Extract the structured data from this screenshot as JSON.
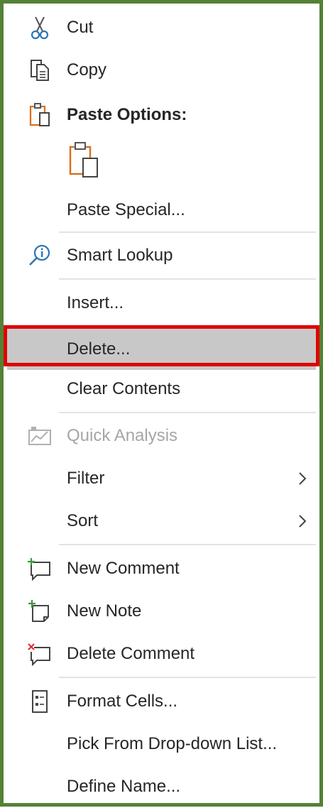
{
  "menu": {
    "items": [
      {
        "label": "Cut",
        "icon": "scissors-icon"
      },
      {
        "label": "Copy",
        "icon": "copy-icon"
      },
      {
        "label": "Paste Options:",
        "icon": "paste-icon"
      },
      {
        "label": "Paste Special...",
        "icon": ""
      },
      {
        "label": "Smart Lookup",
        "icon": "smart-lookup-icon"
      },
      {
        "label": "Insert...",
        "icon": ""
      },
      {
        "label": "Delete...",
        "icon": "",
        "selected": true
      },
      {
        "label": "Clear Contents",
        "icon": ""
      },
      {
        "label": "Quick Analysis",
        "icon": "quick-analysis-icon",
        "disabled": true
      },
      {
        "label": "Filter",
        "icon": "",
        "submenu": true
      },
      {
        "label": "Sort",
        "icon": "",
        "submenu": true
      },
      {
        "label": "New Comment",
        "icon": "new-comment-icon"
      },
      {
        "label": "New Note",
        "icon": "new-note-icon"
      },
      {
        "label": "Delete Comment",
        "icon": "delete-comment-icon"
      },
      {
        "label": "Format Cells...",
        "icon": "format-cells-icon"
      },
      {
        "label": "Pick From Drop-down List...",
        "icon": ""
      },
      {
        "label": "Define Name...",
        "icon": ""
      }
    ],
    "paste_option_icon": "paste-keep-source-icon"
  },
  "colors": {
    "frame": "#548235",
    "highlight_border": "#e00000",
    "selected_bg": "#c8c8c8",
    "icon_blue": "#2e75b6",
    "icon_orange": "#d86f1c",
    "icon_green": "#3a9a3a",
    "icon_red": "#e03030"
  }
}
